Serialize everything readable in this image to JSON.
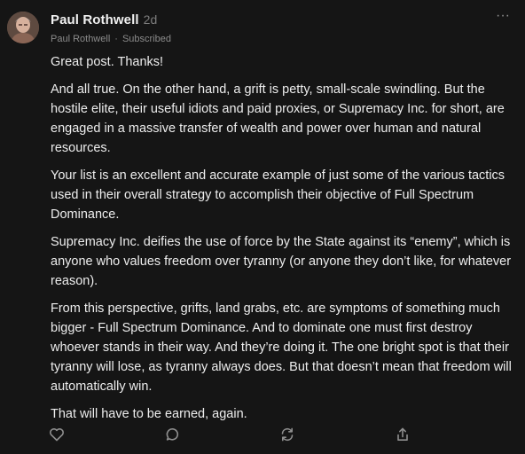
{
  "comment": {
    "author": "Paul Rothwell",
    "age": "2d",
    "meta_name": "Paul Rothwell",
    "meta_separator": "·",
    "meta_status": "Subscribed",
    "more_label": "···",
    "paragraphs": [
      "Great post. Thanks!",
      "And all true. On the other hand, a grift is petty, small-scale swindling. But the hostile elite, their useful idiots and paid proxies, or Supremacy Inc. for short, are engaged in a massive transfer of wealth and power over human and natural resources.",
      "Your list is an excellent and accurate example of just some of the various tactics used in their overall strategy to accomplish their objective of Full Spectrum Dominance.",
      "Supremacy Inc. deifies the use of force by the State against its “enemy”, which is anyone who values freedom over tyranny (or anyone they don’t like, for whatever reason).",
      "From this perspective, grifts, land grabs, etc. are symptoms of something much bigger - Full Spectrum Dominance. And to dominate one must first destroy whoever stands in their way. And they’re doing it. The one bright spot is that their tyranny will lose, as tyranny always does. But that doesn’t mean that freedom will automatically win.",
      "That will have to be earned, again."
    ]
  },
  "actions": [
    {
      "name": "like-button",
      "icon": "heart-icon"
    },
    {
      "name": "reply-button",
      "icon": "comment-icon"
    },
    {
      "name": "restack-button",
      "icon": "restack-icon"
    },
    {
      "name": "share-button",
      "icon": "share-icon"
    }
  ],
  "colors": {
    "background": "#151515",
    "text": "#ededed",
    "muted": "#8b8b8b"
  }
}
